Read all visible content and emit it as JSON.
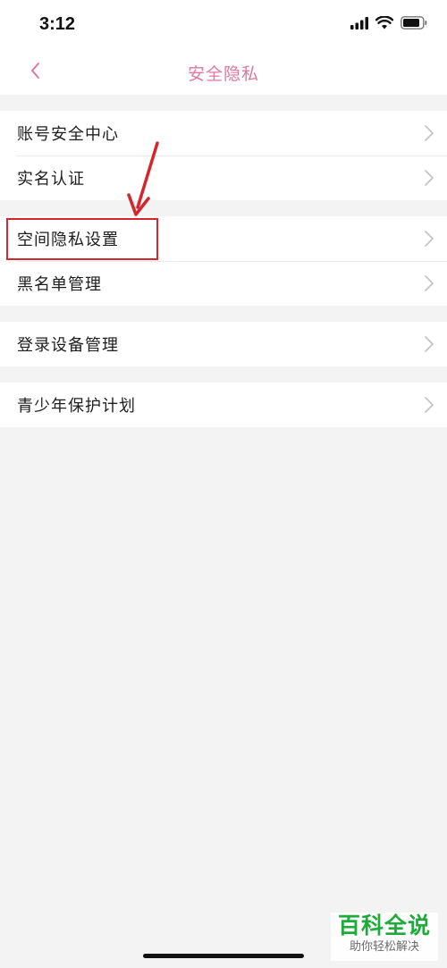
{
  "status_bar": {
    "time": "3:12",
    "icons": [
      "cellular-signal-icon",
      "wifi-icon",
      "battery-icon"
    ]
  },
  "nav": {
    "back_icon": "chevron-left-icon",
    "title": "安全隐私"
  },
  "groups": [
    {
      "items": [
        {
          "label": "账号安全中心"
        },
        {
          "label": "实名认证"
        }
      ]
    },
    {
      "items": [
        {
          "label": "空间隐私设置"
        },
        {
          "label": "黑名单管理"
        }
      ]
    },
    {
      "items": [
        {
          "label": "登录设备管理"
        }
      ]
    },
    {
      "items": [
        {
          "label": "青少年保护计划"
        }
      ]
    }
  ],
  "annotation": {
    "highlighted_item": "空间隐私设置",
    "color": "#d4262c"
  },
  "watermark": {
    "main": "百科全说",
    "sub": "助你轻松解决"
  },
  "colors": {
    "accent": "#e0789a",
    "background": "#f3f3f3",
    "watermark_green": "#1faa3b"
  }
}
